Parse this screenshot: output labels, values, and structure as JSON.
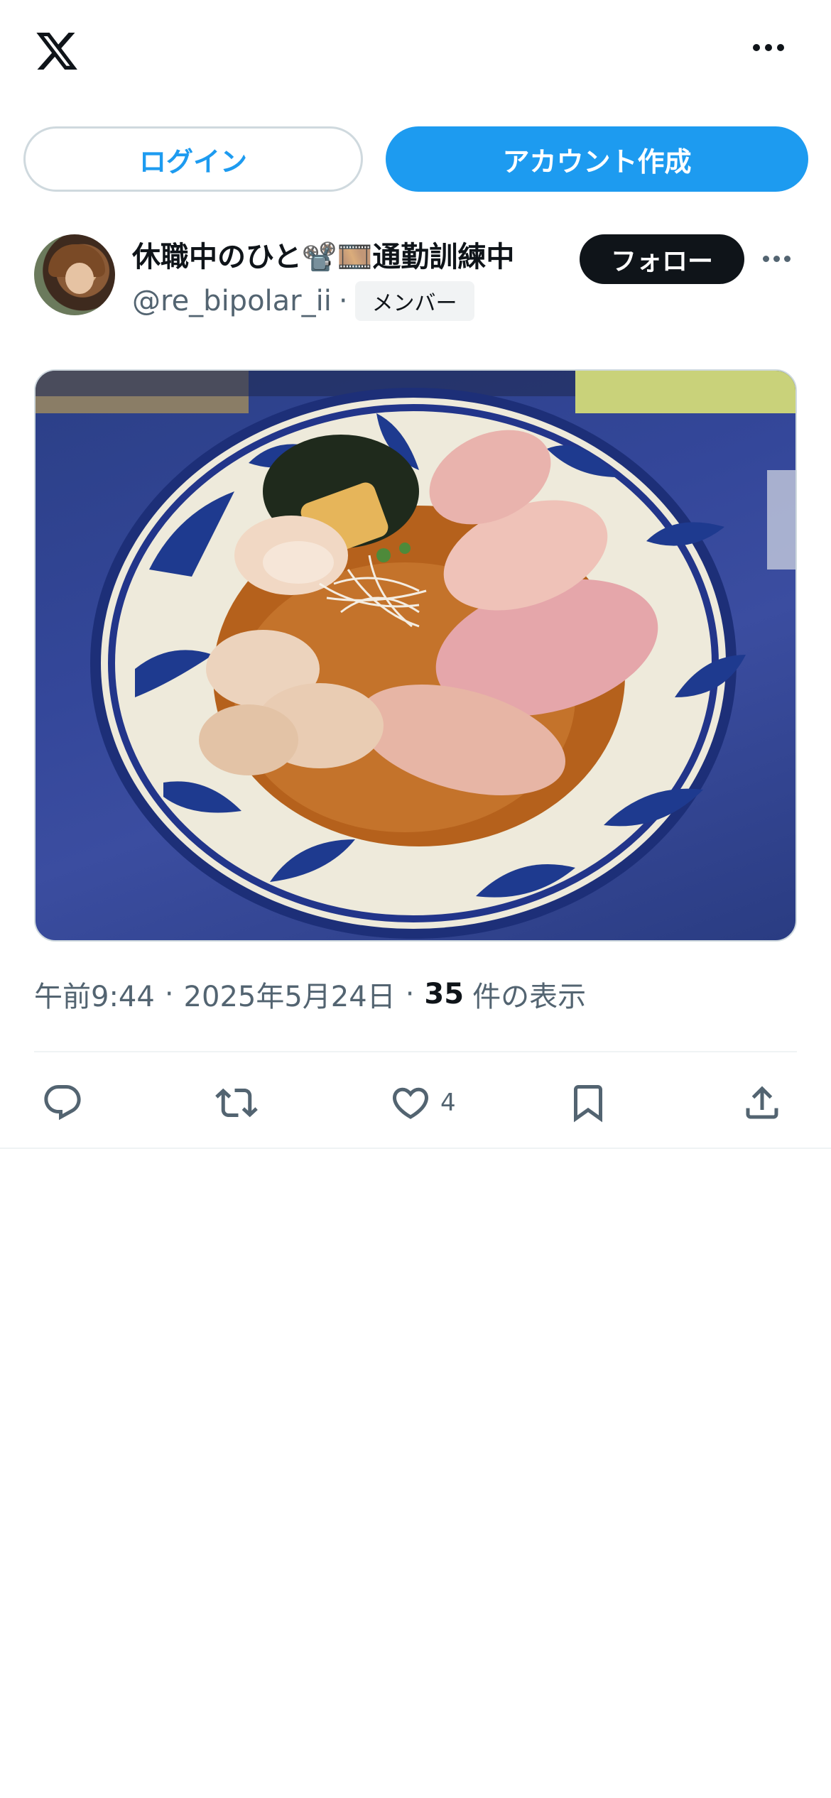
{
  "header": {
    "logo_icon": "x-logo-icon",
    "more_icon": "more-horizontal-icon"
  },
  "auth": {
    "login_label": "ログイン",
    "signup_label": "アカウント作成"
  },
  "post": {
    "author": {
      "display_name": "休職中のひと📽️🎞️通勤訓練中",
      "handle": "@re_bipolar_ii",
      "separator": "·",
      "badge": "メンバー",
      "follow_label": "フォロー"
    },
    "image_description_icon": "ramen-photo",
    "meta": {
      "time": "午前9:44",
      "separator": "·",
      "date": "2025年5月24日",
      "views_count": "35",
      "views_label": "件の表示"
    },
    "actions": {
      "reply_icon": "reply-icon",
      "repost_icon": "repost-icon",
      "like_icon": "heart-icon",
      "like_count": "4",
      "bookmark_icon": "bookmark-icon",
      "share_icon": "share-icon"
    }
  },
  "colors": {
    "brand": "#1d9bf0",
    "text_primary": "#0f1419",
    "text_secondary": "#536471",
    "border": "#cfd9de"
  }
}
